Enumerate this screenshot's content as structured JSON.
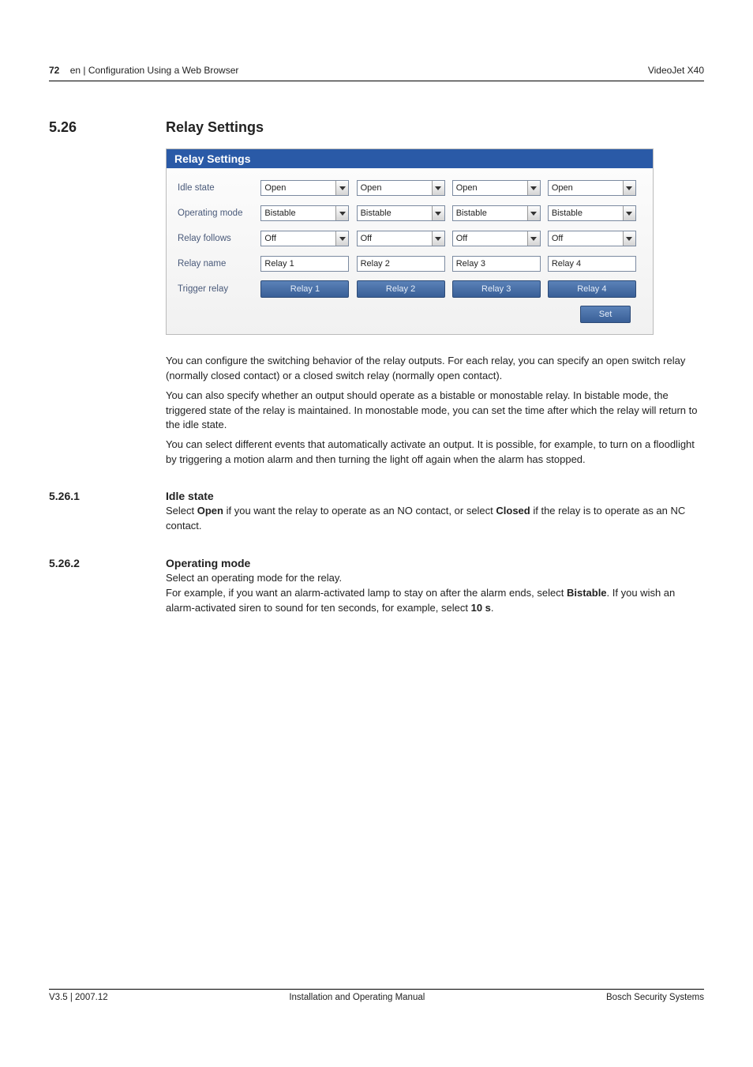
{
  "header": {
    "page_number": "72",
    "breadcrumb": "en | Configuration Using a Web Browser",
    "product": "VideoJet X40"
  },
  "section": {
    "number": "5.26",
    "title": "Relay Settings"
  },
  "panel": {
    "title": "Relay Settings",
    "rows": {
      "idle_state": {
        "label": "Idle state",
        "values": [
          "Open",
          "Open",
          "Open",
          "Open"
        ]
      },
      "operating_mode": {
        "label": "Operating mode",
        "values": [
          "Bistable",
          "Bistable",
          "Bistable",
          "Bistable"
        ]
      },
      "relay_follows": {
        "label": "Relay follows",
        "values": [
          "Off",
          "Off",
          "Off",
          "Off"
        ]
      },
      "relay_name": {
        "label": "Relay name",
        "values": [
          "Relay 1",
          "Relay 2",
          "Relay 3",
          "Relay 4"
        ]
      },
      "trigger_relay": {
        "label": "Trigger relay",
        "buttons": [
          "Relay 1",
          "Relay 2",
          "Relay 3",
          "Relay 4"
        ]
      }
    },
    "set_button": "Set"
  },
  "body": {
    "p1": "You can configure the switching behavior of the relay outputs. For each relay, you can specify an open switch relay (normally closed contact) or a closed switch relay (normally open contact).",
    "p2": "You can also specify whether an output should operate as a bistable or monostable relay. In bistable mode, the triggered state of the relay is maintained. In monostable mode, you can set the time after which the relay will return to the idle state.",
    "p3": "You can select different events that automatically activate an output. It is possible, for example, to turn on a floodlight by triggering a motion alarm and then turning the light off again when the alarm has stopped."
  },
  "sub1": {
    "number": "5.26.1",
    "title": "Idle state",
    "text_pre": "Select ",
    "bold1": "Open",
    "text_mid": " if you want the relay to operate as an NO contact, or select ",
    "bold2": "Closed",
    "text_post": " if the relay is to operate as an NC contact."
  },
  "sub2": {
    "number": "5.26.2",
    "title": "Operating mode",
    "line1": "Select an operating mode for the relay.",
    "line2_pre": "For example, if you want an alarm-activated lamp to stay on after the alarm ends, select ",
    "line2_bold": "Bistable",
    "line2_post": ". If you wish an alarm-activated siren to sound for ten seconds, for example, select ",
    "line3_bold": "10 s",
    "line3_post": "."
  },
  "footer": {
    "left": "V3.5 | 2007.12",
    "center": "Installation and Operating Manual",
    "right": "Bosch Security Systems"
  }
}
